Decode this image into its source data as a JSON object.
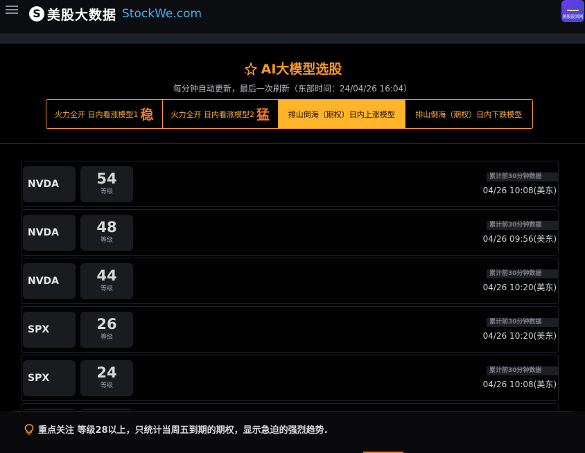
{
  "header": {
    "logo_mark": "S",
    "logo_cn": "美股大数据",
    "logo_en": "StockWe.com",
    "corner_app_label": "美股投资网"
  },
  "panel": {
    "title": "AI大模型选股",
    "subtitle": "每分钟自动更新，最后一次刷新（东部时间：24/04/26 16:04）",
    "tabs": [
      {
        "label": "火力全开 日内看涨模型1",
        "big": "稳",
        "active": false
      },
      {
        "label": "火力全开 日内看涨模型2",
        "big": "猛",
        "active": false
      },
      {
        "label": "排山倒海（期权）日内上涨模型",
        "big": "",
        "active": true
      },
      {
        "label": "排山倒海（期权）日内下跌模型",
        "big": "",
        "active": false
      }
    ]
  },
  "list": {
    "level_label": "等级",
    "tag": "累计前30分钟数据",
    "rows": [
      {
        "ticker": "NVDA",
        "level": "54",
        "time": "04/26 10:08(美东)"
      },
      {
        "ticker": "NVDA",
        "level": "48",
        "time": "04/26 09:56(美东)"
      },
      {
        "ticker": "NVDA",
        "level": "44",
        "time": "04/26 10:20(美东)"
      },
      {
        "ticker": "SPX",
        "level": "26",
        "time": "04/26 10:20(美东)"
      },
      {
        "ticker": "SPX",
        "level": "24",
        "time": "04/26 10:08(美东)"
      },
      {
        "ticker": "",
        "level": "",
        "time": ""
      }
    ]
  },
  "footer": {
    "note": "重点关注 等级28以上，只统计当周五到期的期权，显示急迫的强烈趋势."
  },
  "colors": {
    "accent": "#ff9a1c",
    "active_tab": "#ffb429",
    "brand_en": "#3fb5f2"
  }
}
